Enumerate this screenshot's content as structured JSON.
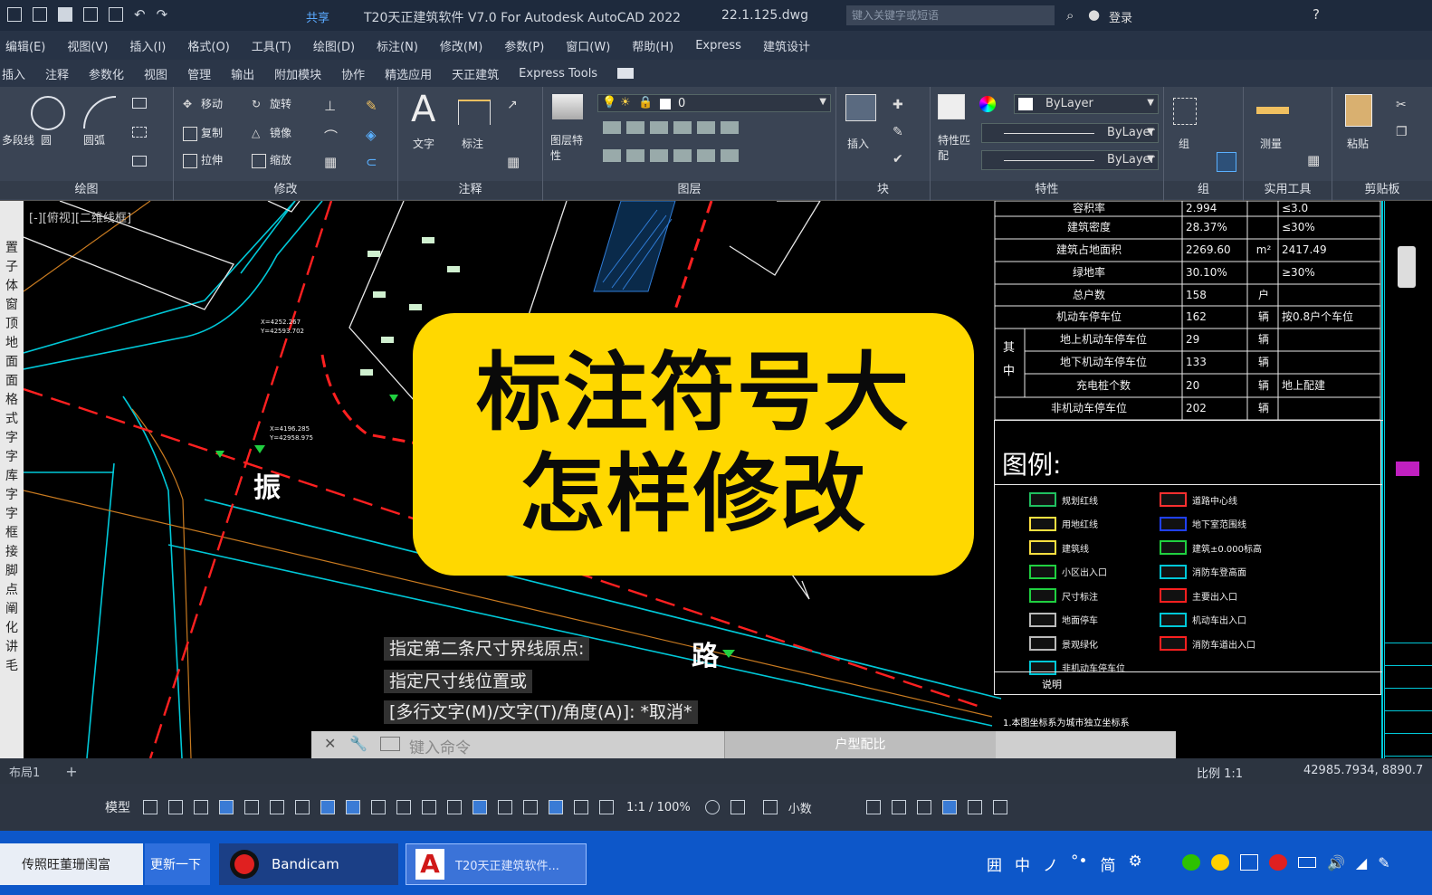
{
  "titlebar": {
    "title": "T20天正建筑软件 V7.0 For Autodesk AutoCAD 2022",
    "filename": "22.1.125.dwg",
    "share": "共享",
    "login": "登录",
    "search_placeholder": "键入关键字或短语"
  },
  "menu": [
    "编辑(E)",
    "视图(V)",
    "插入(I)",
    "格式(O)",
    "工具(T)",
    "绘图(D)",
    "标注(N)",
    "修改(M)",
    "参数(P)",
    "窗口(W)",
    "帮助(H)",
    "Express",
    "建筑设计"
  ],
  "ribbon_tabs": [
    "插入",
    "注释",
    "参数化",
    "视图",
    "管理",
    "输出",
    "附加模块",
    "协作",
    "精选应用",
    "天正建筑",
    "Express Tools"
  ],
  "ribbon": {
    "draw": {
      "label": "绘图",
      "items": [
        "多段线",
        "圆",
        "圆弧"
      ]
    },
    "modify": {
      "label": "修改",
      "items": [
        "移动",
        "旋转",
        "复制",
        "镜像",
        "拉伸",
        "缩放"
      ]
    },
    "annotation": {
      "label": "注释",
      "items": [
        "文字",
        "标注"
      ]
    },
    "layers": {
      "label": "图层",
      "items": [
        "图层特性"
      ],
      "current_layer": "0"
    },
    "block": {
      "label": "块",
      "items": [
        "插入"
      ]
    },
    "properties": {
      "label": "特性",
      "items": [
        "特性匹配"
      ],
      "color": "ByLayer",
      "linetype": "ByLayer",
      "lineweight": "ByLayer"
    },
    "groups": {
      "label": "组",
      "items": [
        "组"
      ]
    },
    "utilities": {
      "label": "实用工具",
      "items": [
        "测量"
      ]
    },
    "clipboard": {
      "label": "剪贴板",
      "items": [
        "粘贴"
      ]
    }
  },
  "viewport_label": "[-][俯视][二维线框]",
  "left_palette": [
    "置",
    "子",
    "体",
    "窗",
    "顶",
    "地",
    "面",
    "面",
    "格",
    "式",
    "字",
    "字",
    "库",
    "字",
    "字",
    "框",
    "接",
    "脚",
    "点",
    "阐",
    "化",
    "讲",
    "毛"
  ],
  "overlay": {
    "line1": "标注符号大",
    "line2": "怎样修改"
  },
  "drawing_labels": {
    "street1": "振",
    "street2": "路",
    "coord1": "X=4252.267",
    "coord2": "Y=42593.702",
    "coord3": "X=4196.285",
    "coord4": "Y=42958.975"
  },
  "table": {
    "rows": [
      [
        "容积率",
        "2.994",
        "",
        "≤3.0"
      ],
      [
        "建筑密度",
        "28.37%",
        "",
        "≤30%"
      ],
      [
        "建筑占地面积",
        "2269.60",
        "m²",
        "2417.49"
      ],
      [
        "绿地率",
        "30.10%",
        "",
        "≥30%"
      ],
      [
        "总户数",
        "158",
        "户",
        ""
      ],
      [
        "机动车停车位",
        "162",
        "辆",
        "按0.8户个车位"
      ],
      [
        "地上机动车停车位",
        "29",
        "辆",
        ""
      ],
      [
        "地下机动车停车位",
        "133",
        "辆",
        ""
      ],
      [
        "充电桩个数",
        "20",
        "辆",
        "地上配建"
      ],
      [
        "非机动车停车位",
        "202",
        "辆",
        ""
      ]
    ],
    "sub_group": "其中"
  },
  "legend": {
    "title": "图例:",
    "items_left": [
      "规划红线",
      "用地红线",
      "建筑线",
      "小区出入口",
      "尺寸标注",
      "地面停车",
      "景观绿化",
      "非机动车停车位"
    ],
    "items_right": [
      "道路中心线",
      "地下室范围线",
      "建筑±0.000标高",
      "消防车登高面",
      "主要出入口",
      "机动车出入口",
      "消防车道出入口"
    ],
    "note_title": "说明",
    "note_text": "1.本图坐标系为城市独立坐标系"
  },
  "command": {
    "line1": "指定第二条尺寸界线原点:",
    "line2": "指定尺寸线位置或",
    "line3": "[多行文字(M)/文字(T)/角度(A)]: *取消*",
    "input_placeholder": "键入命令",
    "side": "户型配比"
  },
  "layout_tab": "布局1",
  "status": {
    "scale": "比例 1:1",
    "coords": "42985.7934, 8890.7",
    "model": "模型",
    "anno": "1:1 / 100%",
    "units": "小数"
  },
  "taskbar": {
    "item1": "传照旺董珊闺富",
    "item2": "更新一下",
    "bandicam": "Bandicam",
    "autocad": "T20天正建筑软件...",
    "tray_chars": [
      "囲",
      "中",
      "ノ",
      "°•",
      "简"
    ]
  },
  "colors": {
    "overlay": "#ffd800",
    "table_border": "#e8e8e8",
    "road_red": "#ff2020",
    "cyan": "#00c8d8",
    "taskbar": "#0d57c9"
  }
}
